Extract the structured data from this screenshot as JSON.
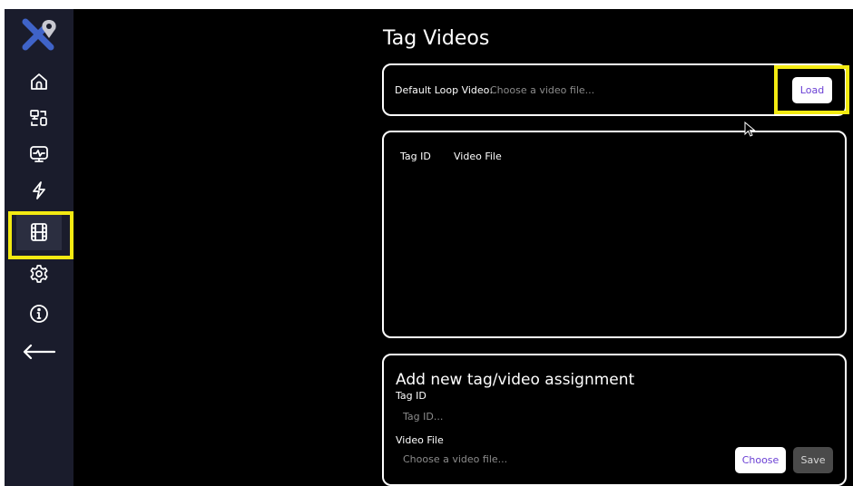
{
  "page": {
    "title": "Tag Videos"
  },
  "sidebar": {
    "items": [
      {
        "icon": "home-icon"
      },
      {
        "icon": "devices-icon"
      },
      {
        "icon": "monitor-icon"
      },
      {
        "icon": "lightning-icon"
      },
      {
        "icon": "film-icon",
        "active": true
      },
      {
        "icon": "gear-icon"
      },
      {
        "icon": "info-icon"
      },
      {
        "icon": "back-arrow-icon"
      }
    ]
  },
  "default_loop": {
    "label": "Default Loop Video:",
    "placeholder": "Choose a video file...",
    "load_label": "Load"
  },
  "tag_table": {
    "columns": [
      "Tag ID",
      "Video File"
    ]
  },
  "new_assignment": {
    "title": "Add new tag/video assignment",
    "tag_label": "Tag ID",
    "tag_placeholder": "Tag ID...",
    "file_label": "Video File",
    "file_placeholder": "Choose a video file...",
    "choose_label": "Choose",
    "save_label": "Save"
  },
  "colors": {
    "sidebar": "#1a1c2c",
    "highlight": "#f3ea12",
    "accent_text": "#6a3fd4"
  }
}
